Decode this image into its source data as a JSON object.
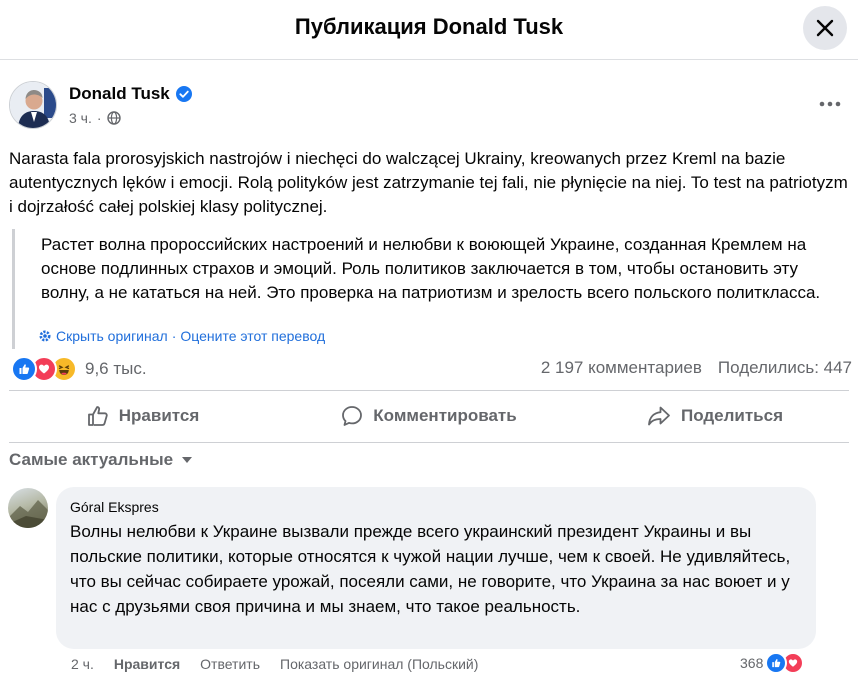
{
  "header": {
    "title": "Публикация Donald Tusk"
  },
  "post": {
    "author": "Donald Tusk",
    "time": "3 ч.",
    "text": "Narasta fala prorosyjskich nastrojów i niechęci do walczącej Ukrainy, kreowanych przez Kreml na bazie autentycznych lęków i emocji. Rolą polityków jest zatrzymanie tej fali, nie płynięcie na niej. To test na patriotyzm i dojrzałość całej polskiej klasy politycznej.",
    "translation": "Растет волна пророссийских настроений и нелюбви к воюющей Украине, созданная Кремлем на основе подлинных страхов и эмоций. Роль политиков заключается в том, чтобы остановить эту волну, а не кататься на ней. Это проверка на патриотизм и зрелость всего польского политкласса.",
    "hide_original": "Скрыть оригинал",
    "rate_translation": "Оцените этот перевод",
    "separator": "·",
    "reactions_count": "9,6 тыс.",
    "comments_count": "2 197 комментариев",
    "shares_count": "Поделились: 447"
  },
  "actions": {
    "like": "Нравится",
    "comment": "Комментировать",
    "share": "Поделиться"
  },
  "sort": {
    "label": "Самые актуальные"
  },
  "comment": {
    "author": "Góral Ekspres",
    "text": "Волны нелюбви к Украине вызвали прежде всего украинский президент Украины и вы польские политики, которые относятся к чужой нации лучше, чем к своей. Не удивляйтесь, что вы сейчас собираете урожай, посеяли сами, не говорите, что Украина за нас воюет и у нас с друзьями своя причина и мы знаем, что такое реальность.",
    "time": "2 ч.",
    "like": "Нравится",
    "reply": "Ответить",
    "show_original": "Показать оригинал (Польский)",
    "reactions_count": "368"
  },
  "colors": {
    "link": "#216fdb",
    "like_blue": "#1877f2",
    "love_red": "#f33e58",
    "haha_yellow": "#f7b928",
    "secondary_text": "#65676b"
  },
  "icons": [
    "close-icon",
    "verified-icon",
    "globe-icon",
    "more-icon",
    "like-reaction-icon",
    "love-reaction-icon",
    "haha-reaction-icon",
    "thumbs-up-icon",
    "comment-bubble-icon",
    "share-arrow-icon",
    "caret-down-icon",
    "gear-icon"
  ]
}
